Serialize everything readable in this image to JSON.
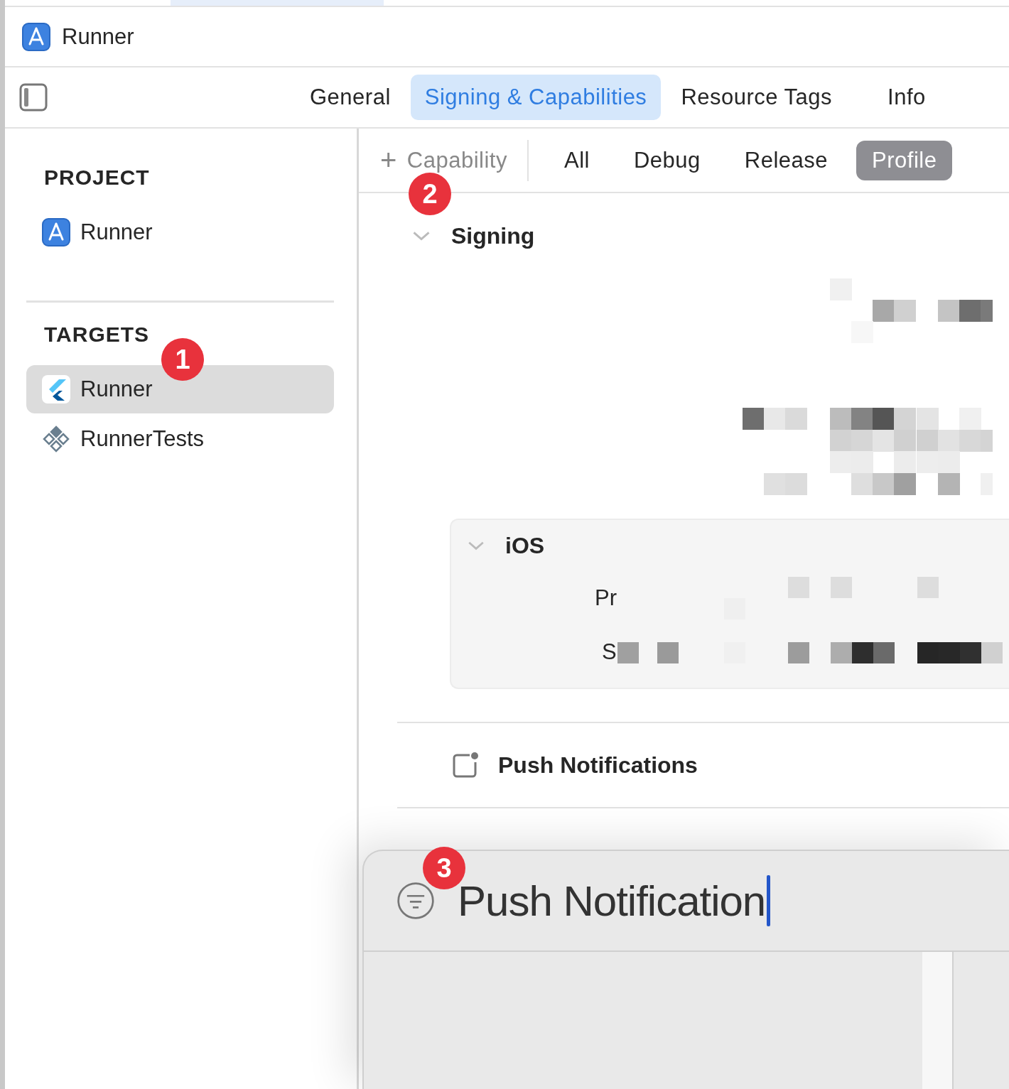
{
  "project_header": {
    "title": "Runner"
  },
  "tabs": [
    {
      "label": "General",
      "selected": false
    },
    {
      "label": "Signing & Capabilities",
      "selected": true
    },
    {
      "label": "Resource Tags",
      "selected": false
    },
    {
      "label": "Info",
      "selected": false
    }
  ],
  "sidebar": {
    "sections": [
      {
        "title": "PROJECT",
        "items": [
          {
            "label": "Runner",
            "kind": "project",
            "selected": false
          }
        ]
      },
      {
        "title": "TARGETS",
        "items": [
          {
            "label": "Runner",
            "kind": "app",
            "selected": true,
            "marker": "1"
          },
          {
            "label": "RunnerTests",
            "kind": "tests",
            "selected": false
          }
        ]
      }
    ]
  },
  "toolbar": {
    "add_button": {
      "icon": "+",
      "label": "Capability",
      "marker": "2"
    },
    "filters": [
      {
        "label": "All",
        "selected": false
      },
      {
        "label": "Debug",
        "selected": false
      },
      {
        "label": "Release",
        "selected": false
      },
      {
        "label": "Profile",
        "selected": true
      }
    ]
  },
  "signing": {
    "title": "Signing",
    "expanded": true,
    "ios": {
      "title": "iOS",
      "expanded": true,
      "rows": [
        {
          "label": "Pr"
        },
        {
          "label": "S"
        }
      ]
    }
  },
  "capabilities": [
    {
      "title": "Push Notifications"
    }
  ],
  "library_popup": {
    "search": {
      "value": "Push Notification",
      "marker": "3"
    }
  }
}
